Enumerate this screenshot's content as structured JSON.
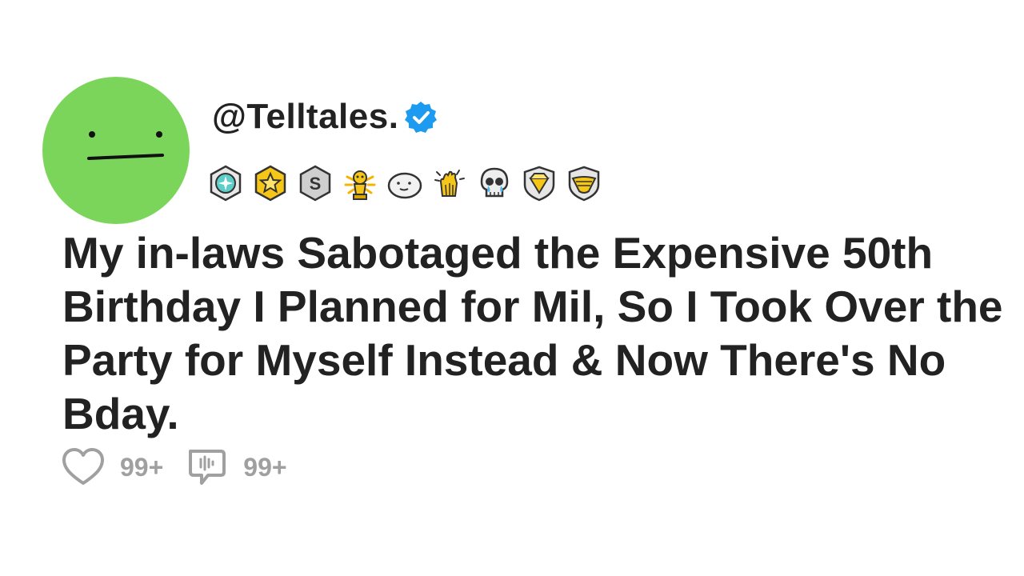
{
  "user": {
    "handle": "@Telltales."
  },
  "awards": [
    "diamond-medal-icon",
    "gold-star-medal-icon",
    "silver-s-medal-icon",
    "gold-trophy-icon",
    "seal-icon",
    "clapping-hands-icon",
    "crying-skull-icon",
    "gold-gem-badge-icon",
    "wings-badge-icon"
  ],
  "post": {
    "title": "My in-laws Sabotaged the Expensive 50th Birthday I Planned for Mil, So I Took Over the Party for Myself Instead & Now There's No Bday."
  },
  "stats": {
    "likes": "99+",
    "comments": "99+"
  },
  "colors": {
    "avatar": "#7bd55a",
    "verified": "#1d9bf0",
    "text": "#222222",
    "muted": "#a0a0a0"
  }
}
